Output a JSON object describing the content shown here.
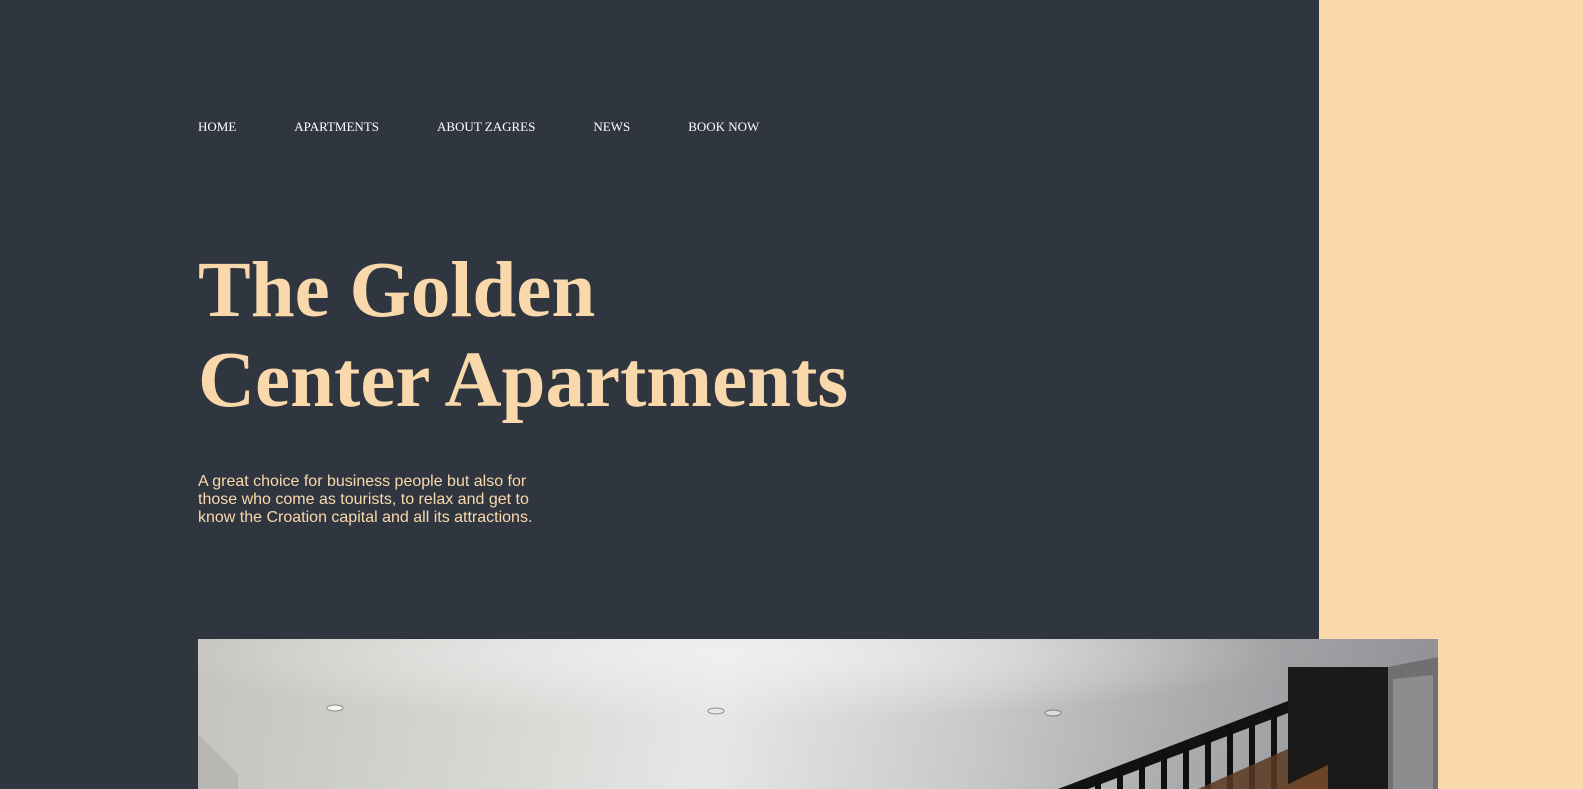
{
  "nav": {
    "items": [
      {
        "label": "HOME"
      },
      {
        "label": "APARTMENTS"
      },
      {
        "label": "ABOUT ZAGRES"
      },
      {
        "label": "NEWS"
      },
      {
        "label": "BOOK NOW"
      }
    ]
  },
  "hero": {
    "title_line1": "The Golden",
    "title_line2": "Center Apartments",
    "subtitle": "A great choice for business people but also for those who come as tourists, to relax and get to know the Croation capital and all its attractions.",
    "image_alt": "Apartment interior with staircase"
  },
  "colors": {
    "background_dark": "#30363f",
    "accent": "#f9d8ac",
    "nav_text": "#ffffff"
  }
}
